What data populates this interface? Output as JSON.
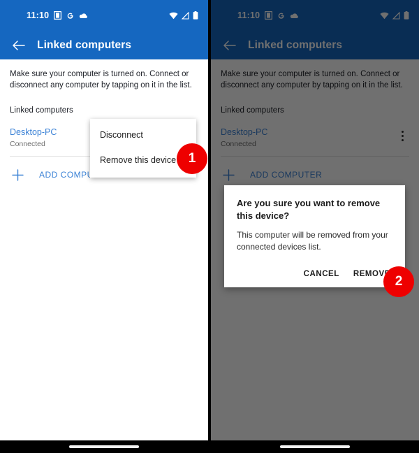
{
  "status_bar": {
    "time": "11:10",
    "icons_left": [
      "device-sync-icon",
      "google-g-icon",
      "cloud-icon"
    ],
    "icons_right": [
      "wifi-icon",
      "cellular-signal-off-icon",
      "battery-icon"
    ]
  },
  "app_bar": {
    "back_icon": "arrow-back-icon",
    "title": "Linked computers"
  },
  "content": {
    "intro": "Make sure your computer is turned on. Connect or disconnect any computer by tapping on it in the list.",
    "section_label": "Linked computers",
    "device": {
      "name": "Desktop-PC",
      "status": "Connected",
      "overflow_icon": "overflow-menu-icon"
    },
    "add_computer": {
      "plus_icon": "plus-icon",
      "label": "ADD COMPUTER"
    }
  },
  "popup_menu": {
    "items": [
      {
        "label": "Disconnect"
      },
      {
        "label": "Remove this device"
      }
    ]
  },
  "dialog": {
    "title": "Are you sure you want to remove this device?",
    "body": "This computer will be removed from your connected devices list.",
    "cancel_label": "CANCEL",
    "confirm_label": "REMOVE"
  },
  "badges": {
    "one": "1",
    "two": "2"
  },
  "colors": {
    "app_bar_blue": "#1567c0",
    "accent_link_blue": "#3b82d6",
    "badge_red": "#ee0000",
    "scrim": "rgba(0,0,0,0.56)"
  }
}
